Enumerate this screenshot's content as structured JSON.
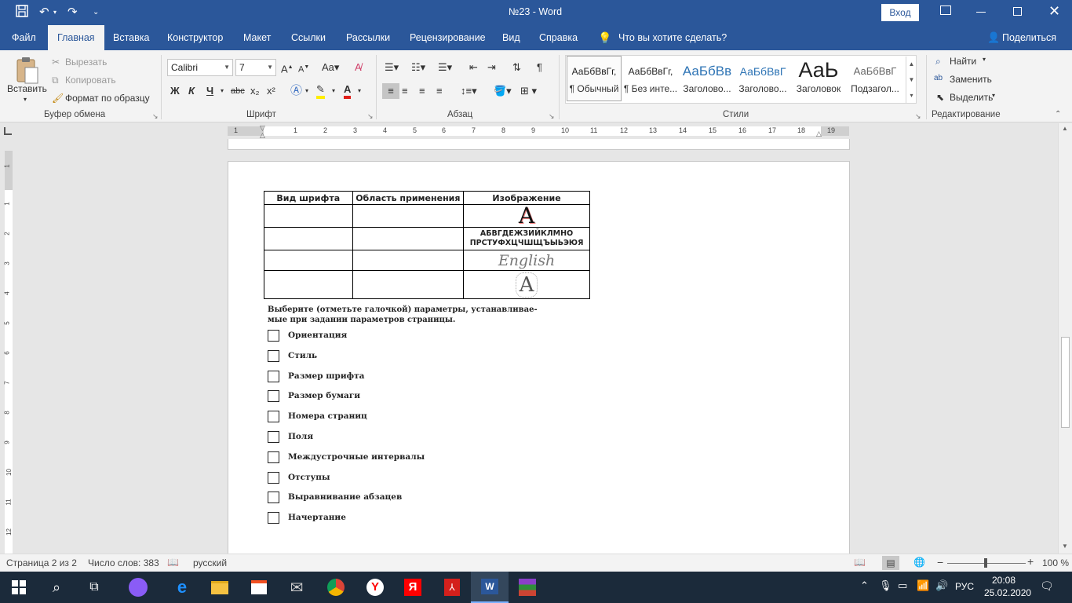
{
  "titlebar": {
    "doc_title": "№23  -  Word",
    "signin": "Вход"
  },
  "tabs": [
    "Файл",
    "Главная",
    "Вставка",
    "Конструктор",
    "Макет",
    "Ссылки",
    "Рассылки",
    "Рецензирование",
    "Вид",
    "Справка"
  ],
  "tell_me": "Что вы хотите сделать?",
  "share": "Поделиться",
  "clipboard": {
    "paste": "Вставить",
    "cut": "Вырезать",
    "copy": "Копировать",
    "format_painter": "Формат по образцу",
    "label": "Буфер обмена"
  },
  "font": {
    "name": "Calibri",
    "size": "7",
    "label": "Шрифт",
    "bold": "Ж",
    "italic": "К",
    "underline": "Ч",
    "strike": "abc",
    "sub": "x₂",
    "sup": "x²"
  },
  "paragraph": {
    "label": "Абзац"
  },
  "styles": {
    "label": "Стили",
    "items": [
      {
        "preview": "АаБбВвГг,",
        "name": "¶ Обычный"
      },
      {
        "preview": "АаБбВвГг,",
        "name": "¶ Без инте..."
      },
      {
        "preview": "АаБбВв",
        "name": "Заголово..."
      },
      {
        "preview": "АаБбВвГ",
        "name": "Заголово..."
      },
      {
        "preview": "АаЬ",
        "name": "Заголовок"
      },
      {
        "preview": "АаБбВвГ",
        "name": "Подзагол..."
      }
    ]
  },
  "editing": {
    "find": "Найти",
    "replace": "Заменить",
    "select": "Выделить",
    "label": "Редактирование"
  },
  "ruler": {
    "numbers": [
      "1",
      "1",
      "2",
      "3",
      "4",
      "5",
      "6",
      "7",
      "8",
      "9",
      "10",
      "11",
      "12",
      "13",
      "14",
      "15",
      "16",
      "17",
      "18",
      "19"
    ]
  },
  "vruler": {
    "numbers": [
      "1",
      "1",
      "2",
      "3",
      "4",
      "5",
      "6",
      "7",
      "8",
      "9",
      "10",
      "11",
      "12"
    ]
  },
  "table": {
    "headers": [
      "Вид шрифта",
      "Область применения",
      "Изображение"
    ],
    "img_row1": "A",
    "img_row2_line1": "АБВГДЕЖЗИЙКЛМНО",
    "img_row2_line2": "ПРСТУФХЦЧШЩЪЫЬЭЮЯ",
    "img_row3": "English",
    "img_row4": "A"
  },
  "question": {
    "line1": "Выберите  (отметьте  галочкой)  параметры,  устанавливае-",
    "line2": "мые при задании параметров страницы."
  },
  "options": [
    "Ориентация",
    "Стиль",
    "Размер шрифта",
    "Размер бумаги",
    "Номера страниц",
    "Поля",
    "Междустрочные интервалы",
    "Отступы",
    "Выравнивание абзацев",
    "Начертание"
  ],
  "status": {
    "page": "Страница 2 из 2",
    "words": "Число слов: 383",
    "lang": "русский",
    "zoom": "100 %"
  },
  "taskbar": {
    "lang": "РУС",
    "time": "20:08",
    "date": "25.02.2020"
  }
}
